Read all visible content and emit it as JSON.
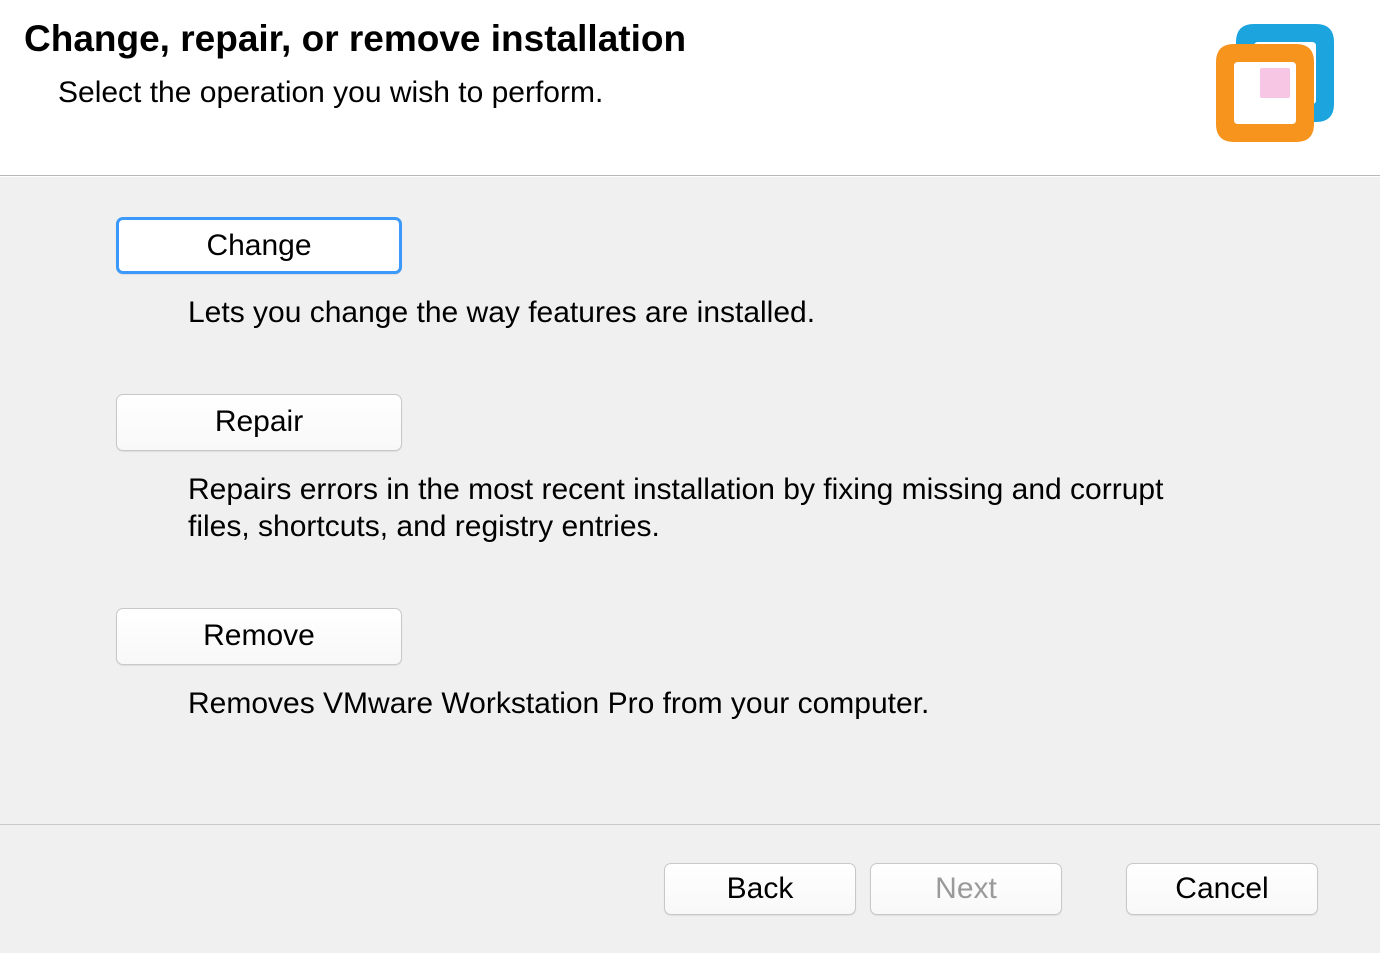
{
  "header": {
    "title": "Change, repair, or remove installation",
    "subtitle": "Select the operation you wish to perform."
  },
  "options": {
    "change": {
      "label": "Change",
      "description": "Lets you change the way features are installed."
    },
    "repair": {
      "label": "Repair",
      "description": "Repairs errors in the most recent installation by fixing missing and corrupt files, shortcuts, and registry entries."
    },
    "remove": {
      "label": "Remove",
      "description": "Removes VMware Workstation Pro from your computer."
    }
  },
  "footer": {
    "back": "Back",
    "next": "Next",
    "cancel": "Cancel"
  },
  "logo": {
    "color_blue": "#1ca4de",
    "color_orange": "#f7941e"
  }
}
